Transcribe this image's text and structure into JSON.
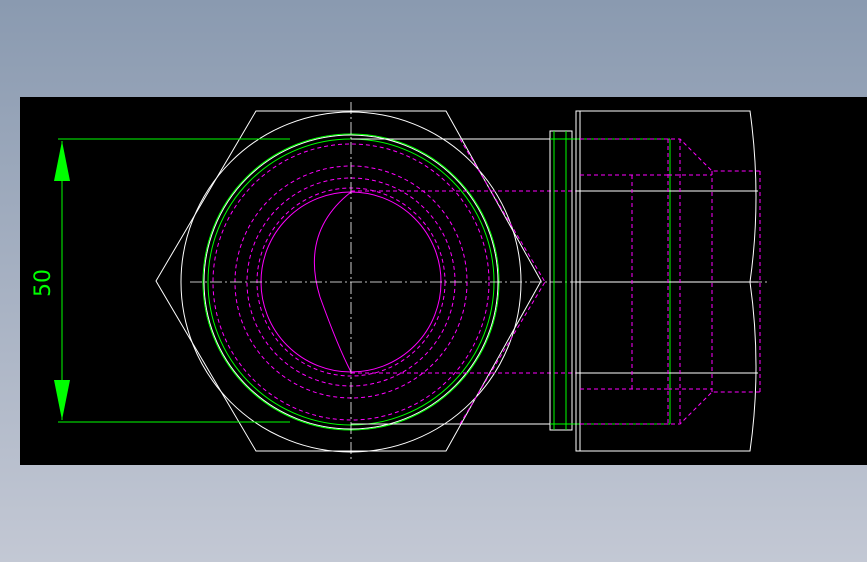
{
  "drawing": {
    "dimension_label": "50",
    "colors": {
      "background": "#000000",
      "outline": "#ffffff",
      "dimension": "#00ff00",
      "hidden": "#ff00ff"
    }
  }
}
